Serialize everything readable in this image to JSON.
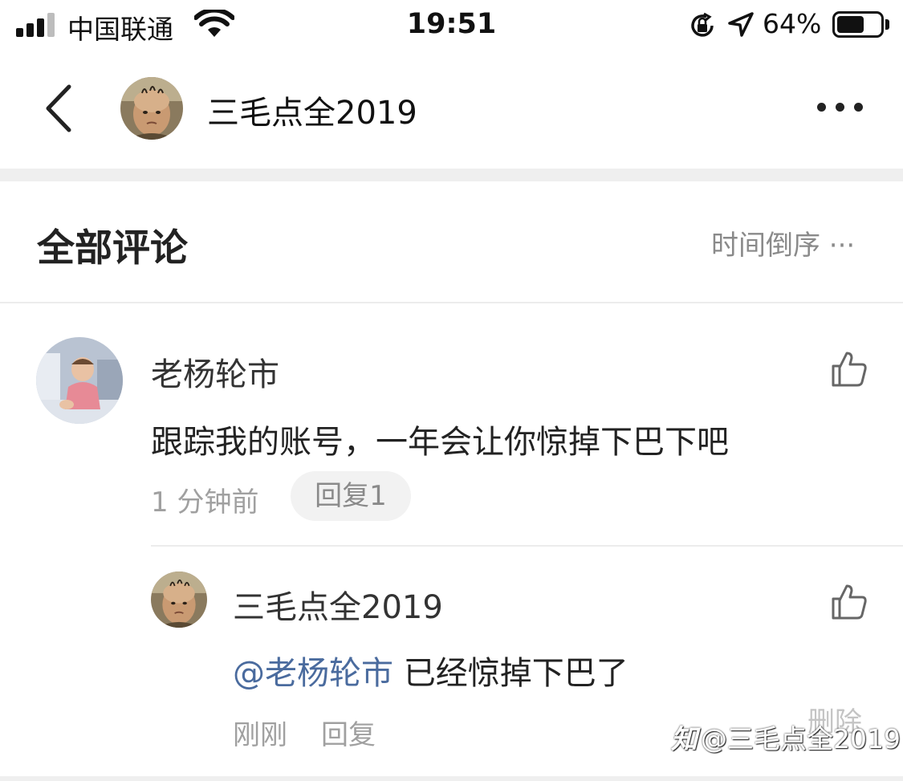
{
  "status_bar": {
    "carrier": "中国联通",
    "time": "19:51",
    "battery_percent_label": "64%",
    "battery_level": 0.64,
    "icons": [
      "signal-icon",
      "wifi-icon",
      "rotation-lock-icon",
      "location-icon",
      "battery-icon"
    ]
  },
  "nav": {
    "title": "三毛点全2019",
    "icons": [
      "back-icon",
      "more-icon"
    ]
  },
  "comments_section": {
    "title": "全部评论",
    "sort_label": "时间倒序 ···"
  },
  "comment": {
    "author": "老杨轮市",
    "text": "跟踪我的账号，一年会让你惊掉下巴下吧",
    "time": "1 分钟前",
    "reply_button": "回复1"
  },
  "reply": {
    "author": "三毛点全2019",
    "mention": "@老杨轮市",
    "text": " 已经惊掉下巴了",
    "time": "刚刚",
    "reply_button": "回复",
    "delete_button": "删除"
  },
  "watermark": {
    "logo": "知",
    "text": "@三毛点全2019"
  },
  "colors": {
    "mention": "#4a6b9e",
    "muted": "#a0a0a0",
    "separator": "#efefef"
  }
}
